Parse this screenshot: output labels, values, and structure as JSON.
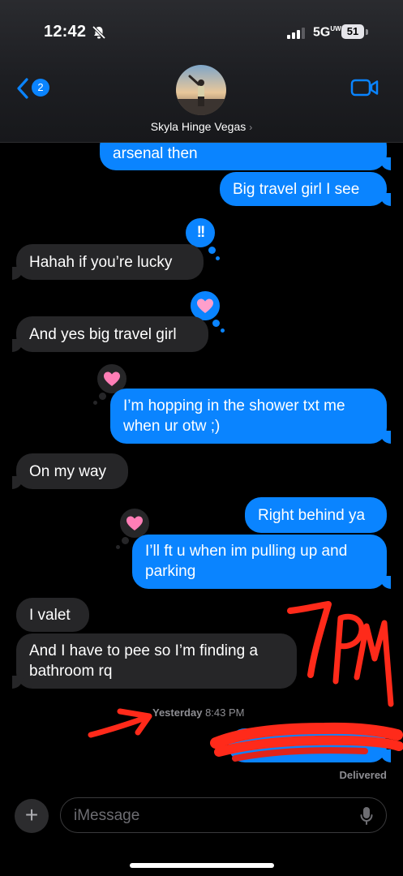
{
  "status_bar": {
    "time": "12:42",
    "network": "5G",
    "network_sup": "UW",
    "battery": "51"
  },
  "header": {
    "back_count": "2",
    "contact_name": "Skyla Hinge Vegas",
    "contact_chevron": "›"
  },
  "messages": [
    {
      "from": "me",
      "text": "arsenal then"
    },
    {
      "from": "me",
      "text": "Big travel girl I see"
    },
    {
      "from": "them",
      "text": "Hahah if you’re lucky",
      "tapback": "!!"
    },
    {
      "from": "them",
      "text": "And yes big travel girl",
      "tapback": "heart"
    },
    {
      "from": "me",
      "lines": [
        "I’m hopping in the shower txt me",
        "when ur otw ;)"
      ],
      "tapback": "heart"
    },
    {
      "from": "them",
      "text": "On my way"
    },
    {
      "from": "me",
      "text": "Right behind ya"
    },
    {
      "from": "me",
      "lines": [
        "I’ll ft u when im pulling up and",
        "parking"
      ],
      "tapback": "heart"
    },
    {
      "from": "them",
      "text": "I valet"
    },
    {
      "from": "them",
      "lines": [
        "And I have to pee so I’m finding a",
        "bathroom rq"
      ]
    },
    {
      "from": "me",
      "text": "",
      "redacted": true
    }
  ],
  "timestamp": {
    "day": "Yesterday",
    "time": "8:43 PM"
  },
  "receipt": "Delivered",
  "composer": {
    "placeholder": "iMessage"
  },
  "annotation": {
    "handwritten_text": "7PM",
    "color": "#ff2a1a"
  },
  "colors": {
    "sent_bubble": "#0a84ff",
    "received_bubble": "#262628",
    "tapback_pink": "#ff7eb6"
  }
}
